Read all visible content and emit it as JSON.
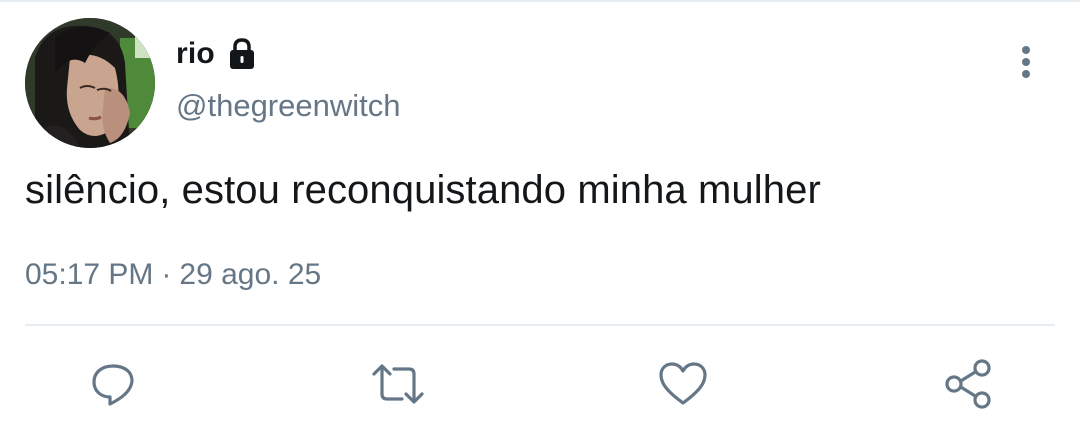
{
  "tweet": {
    "display_name": "rio",
    "handle": "@thegreenwitch",
    "text": "silêncio, estou reconquistando minha mulher",
    "time": "05:17 PM",
    "separator": "·",
    "date": "29 ago. 25"
  },
  "icons": {
    "lock": "lock-icon",
    "more": "vertical-ellipsis-icon",
    "reply": "reply-icon",
    "retweet": "retweet-icon",
    "like": "heart-icon",
    "share": "share-icon"
  },
  "colors": {
    "text_primary": "#14171a",
    "text_secondary": "#657786",
    "icon": "#657786",
    "divider": "#e6ecf0"
  }
}
